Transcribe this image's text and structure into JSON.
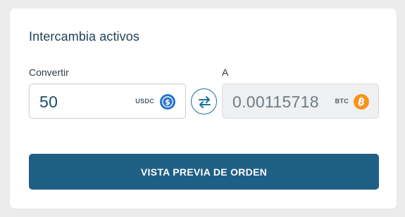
{
  "card": {
    "title": "Intercambia activos"
  },
  "from": {
    "label": "Convertir",
    "amount": "50",
    "ticker": "USDC",
    "icon": "usdc-coin-icon",
    "color": "#2775ca"
  },
  "swap": {
    "icon": "swap-arrows-icon",
    "color": "#1b6f99"
  },
  "to": {
    "label": "A",
    "amount": "0.00115718",
    "ticker": "BTC",
    "icon": "bitcoin-coin-icon",
    "color": "#f7931a"
  },
  "actions": {
    "preview_label": "VISTA PREVIA DE ORDEN",
    "preview_color": "#1f5f85"
  }
}
